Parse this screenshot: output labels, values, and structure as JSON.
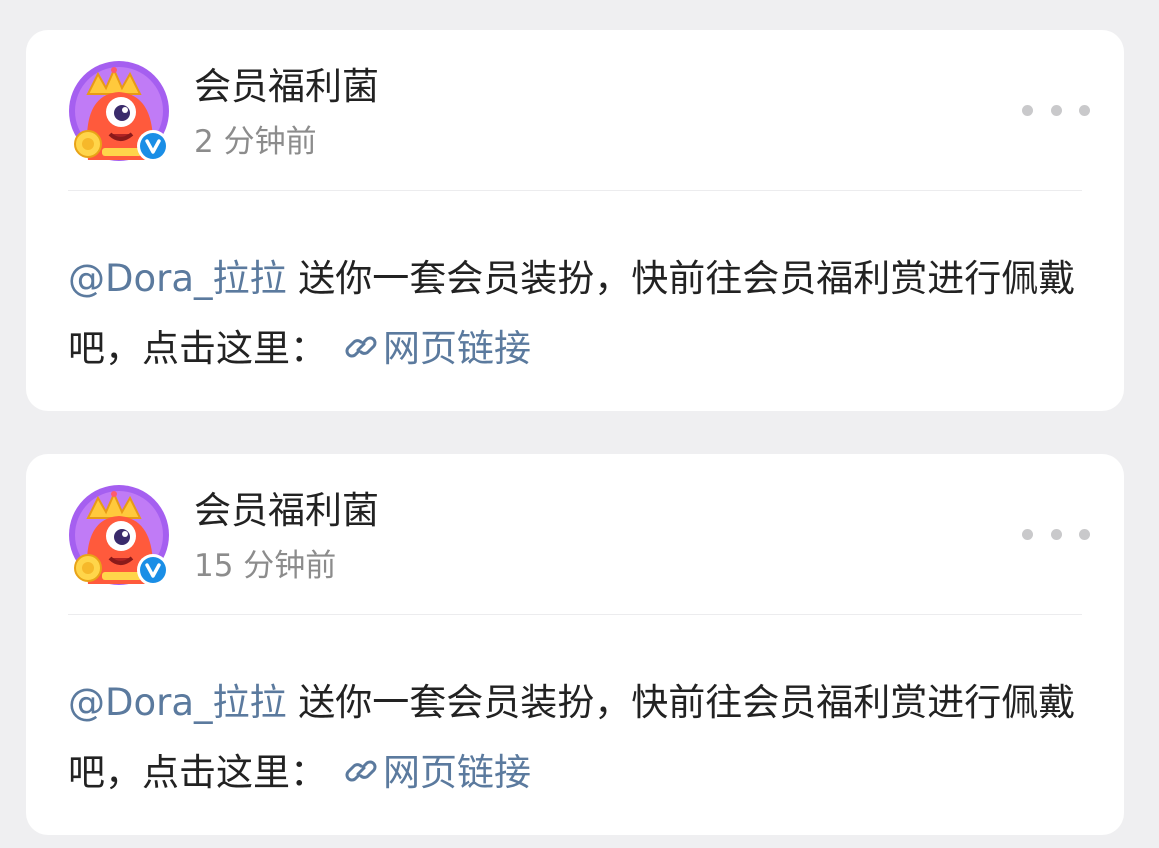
{
  "colors": {
    "background": "#efeff1",
    "card": "#ffffff",
    "text": "#222222",
    "secondary": "#8c8c8c",
    "link": "#5b7a9e",
    "verified_badge": "#1a8ee6",
    "avatar_ring": "#a55ff0"
  },
  "posts": [
    {
      "author": "会员福利菌",
      "time": "2 分钟前",
      "avatar_icon": "red-monster-mascot-avatar",
      "verified_icon": "verified-v-badge-icon",
      "more_icon": "more-dots-icon",
      "mention": "@Dora_拉拉",
      "text": " 送你一套会员装扮，快前往会员福利赏进行佩戴吧，点击这里：",
      "link_icon": "link-chain-icon",
      "link_text": "网页链接"
    },
    {
      "author": "会员福利菌",
      "time": "15 分钟前",
      "avatar_icon": "red-monster-mascot-avatar",
      "verified_icon": "verified-v-badge-icon",
      "more_icon": "more-dots-icon",
      "mention": "@Dora_拉拉",
      "text": " 送你一套会员装扮，快前往会员福利赏进行佩戴吧，点击这里：",
      "link_icon": "link-chain-icon",
      "link_text": "网页链接"
    }
  ]
}
